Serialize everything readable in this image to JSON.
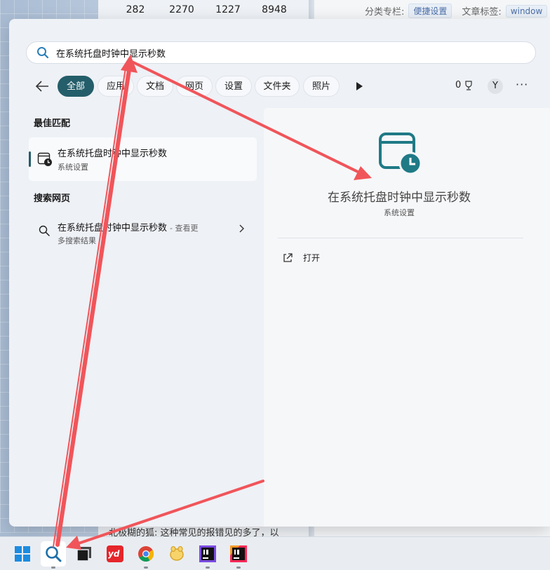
{
  "background": {
    "numbers": [
      "282",
      "2270",
      "1227",
      "8948"
    ],
    "category_label": "分类专栏:",
    "category_chip": "便捷设置",
    "tags_label": "文章标签:",
    "tag_chip": "window",
    "bottom_text": "北极糊的狐: 这种常见的报错见的多了，以"
  },
  "search": {
    "query": "在系统托盘时钟中显示秒数"
  },
  "filters": {
    "items": [
      "全部",
      "应用",
      "文档",
      "网页",
      "设置",
      "文件夹",
      "照片"
    ],
    "active_index": 0,
    "points": "0",
    "avatar": "Y",
    "more": "···"
  },
  "results": {
    "best_match_heading": "最佳匹配",
    "best_match": {
      "title": "在系统托盘时钟中显示秒数",
      "subtitle": "系统设置"
    },
    "web_heading": "搜索网页",
    "web_item": {
      "title": "在系统托盘时钟中显示秒数",
      "hint": "- 查看更",
      "subtitle": "多搜索结果"
    }
  },
  "preview": {
    "title": "在系统托盘时钟中显示秒数",
    "subtitle": "系统设置",
    "open_label": "打开"
  },
  "colors": {
    "accent": "#245e6a",
    "annotation_arrow": "#f0555a"
  },
  "taskbar": {
    "apps": [
      "windows-start-icon",
      "search-icon",
      "task-view-icon",
      "youdao-dictionary-icon",
      "chrome-icon",
      "navicat-icon",
      "intellij-idea-icon",
      "intellij-idea-ultimate-icon"
    ],
    "youdao_text": "yd"
  }
}
